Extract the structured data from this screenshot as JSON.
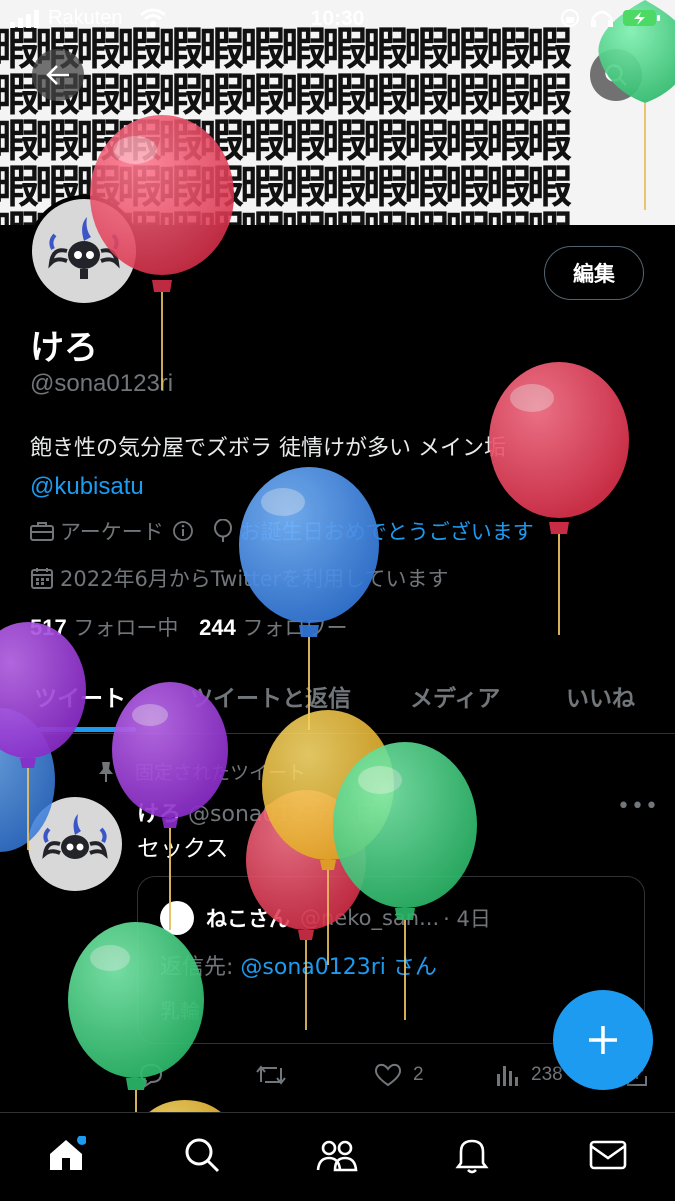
{
  "status_bar": {
    "carrier": "Rakuten",
    "time": "10:30"
  },
  "banner": {
    "pattern_char": "暇"
  },
  "profile": {
    "edit_label": "編集",
    "name": "けろ",
    "handle": "@sona0123ri",
    "bio_text": "飽き性の気分屋でズボラ 徒情けが多い メイン垢",
    "bio_link": "@kubisatu",
    "category": "アーケード",
    "birthday": "お誕生日おめでとうございます",
    "joined": "2022年6月からTwitterを利用しています",
    "following_count": "517",
    "following_label": "フォロー中",
    "followers_count": "244",
    "followers_label": "フォロワー"
  },
  "tabs": [
    "ツイート",
    "ツイートと返信",
    "メディア",
    "いいね"
  ],
  "pinned_tweet": {
    "pinned_label": "固定されたツイート",
    "author_name": "けろ",
    "author_handle": "@sona0123ri",
    "time": "4日",
    "text": "セックス",
    "quote": {
      "author_name": "ねこさん",
      "author_handle": "@neko_san...",
      "time": "· 4日",
      "reply_prefix": "返信先:",
      "reply_to": "@sona0123ri さん",
      "text": "乳輪"
    },
    "likes": "2",
    "views": "238"
  },
  "colors": {
    "accent": "#1d9bf0",
    "background": "#000000",
    "muted": "#71767b"
  }
}
